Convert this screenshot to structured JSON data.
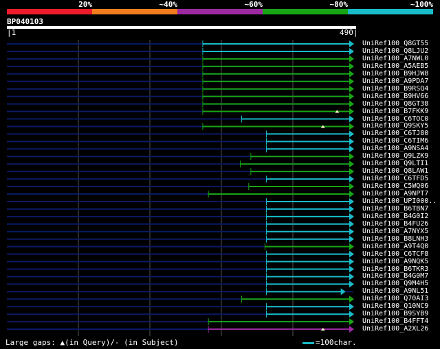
{
  "colors": {
    "background": "#000000",
    "query_line": "#0a1a66",
    "grid": "#555555",
    "id_20": "#ec1c2a",
    "id_40": "#f07c1e",
    "id_60": "#9d2aa0",
    "id_80": "#17a514",
    "id_100": "#19bcc8",
    "gap_marker": "#ffffcc"
  },
  "legend_bar": [
    {
      "label": "20%",
      "color": "#ec1c2a"
    },
    {
      "label": "~40%",
      "color": "#f07c1e"
    },
    {
      "label": "~60%",
      "color": "#9d2aa0"
    },
    {
      "label": "~80%",
      "color": "#17a514"
    },
    {
      "label": "~100%",
      "color": "#19bcc8"
    }
  ],
  "query": {
    "id": "BP040103",
    "start_label": "|1",
    "end_label": "490|",
    "length": 490
  },
  "hits": [
    {
      "label": "UniRef100_Q8GT55",
      "start": 277,
      "end": 490,
      "color": "#19bcc8"
    },
    {
      "label": "UniRef100_Q8LJU2",
      "start": 277,
      "end": 490,
      "color": "#19bcc8"
    },
    {
      "label": "UniRef100_A7NWL0",
      "start": 277,
      "end": 490,
      "color": "#17a514"
    },
    {
      "label": "UniRef100_A5AEB5",
      "start": 277,
      "end": 490,
      "color": "#17a514"
    },
    {
      "label": "UniRef100_B9HJW8",
      "start": 277,
      "end": 490,
      "color": "#17a514"
    },
    {
      "label": "UniRef100_A9PDA7",
      "start": 277,
      "end": 490,
      "color": "#17a514"
    },
    {
      "label": "UniRef100_B9RSQ4",
      "start": 277,
      "end": 490,
      "color": "#17a514"
    },
    {
      "label": "UniRef100_B9HV66",
      "start": 277,
      "end": 490,
      "color": "#17a514"
    },
    {
      "label": "UniRef100_Q8GT38",
      "start": 277,
      "end": 490,
      "color": "#17a514"
    },
    {
      "label": "UniRef100_B7FKK9",
      "start": 277,
      "end": 490,
      "color": "#17a514",
      "gap": 467
    },
    {
      "label": "UniRef100_C6TOC0",
      "start": 332,
      "end": 490,
      "color": "#19bcc8"
    },
    {
      "label": "UniRef100_Q9SKY5",
      "start": 277,
      "end": 490,
      "color": "#17a514",
      "gap": 447
    },
    {
      "label": "UniRef100_C6TJ80",
      "start": 367,
      "end": 490,
      "color": "#19bcc8"
    },
    {
      "label": "UniRef100_C6TIM6",
      "start": 367,
      "end": 490,
      "color": "#19bcc8"
    },
    {
      "label": "UniRef100_A9NSA4",
      "start": 367,
      "end": 490,
      "color": "#19bcc8"
    },
    {
      "label": "UniRef100_Q9LZK9",
      "start": 345,
      "end": 490,
      "color": "#17a514"
    },
    {
      "label": "UniRef100_Q9LTI1",
      "start": 330,
      "end": 490,
      "color": "#17a514"
    },
    {
      "label": "UniRef100_Q8LAW1",
      "start": 345,
      "end": 490,
      "color": "#17a514"
    },
    {
      "label": "UniRef100_C6TFD5",
      "start": 367,
      "end": 490,
      "color": "#19bcc8"
    },
    {
      "label": "UniRef100_C5WQ06",
      "start": 342,
      "end": 490,
      "color": "#17a514"
    },
    {
      "label": "UniRef100_A9NPT7",
      "start": 285,
      "end": 490,
      "color": "#17a514"
    },
    {
      "label": "UniRef100_UPI000..",
      "start": 367,
      "end": 490,
      "color": "#19bcc8"
    },
    {
      "label": "UniRef100_B6TBN7",
      "start": 367,
      "end": 490,
      "color": "#19bcc8"
    },
    {
      "label": "UniRef100_B4G0I2",
      "start": 367,
      "end": 490,
      "color": "#19bcc8"
    },
    {
      "label": "UniRef100_B4FU26",
      "start": 367,
      "end": 490,
      "color": "#19bcc8"
    },
    {
      "label": "UniRef100_A7NYX5",
      "start": 367,
      "end": 490,
      "color": "#19bcc8"
    },
    {
      "label": "UniRef100_B8LNH3",
      "start": 367,
      "end": 490,
      "color": "#19bcc8"
    },
    {
      "label": "UniRef100_A9T4Q0",
      "start": 365,
      "end": 490,
      "color": "#17a514"
    },
    {
      "label": "UniRef100_C6TCF8",
      "start": 367,
      "end": 490,
      "color": "#19bcc8"
    },
    {
      "label": "UniRef100_A9NQK5",
      "start": 367,
      "end": 490,
      "color": "#19bcc8"
    },
    {
      "label": "UniRef100_B6TKR3",
      "start": 367,
      "end": 490,
      "color": "#19bcc8"
    },
    {
      "label": "UniRef100_B4G0M7",
      "start": 367,
      "end": 490,
      "color": "#19bcc8"
    },
    {
      "label": "UniRef100_Q9M4H5",
      "start": 367,
      "end": 490,
      "color": "#19bcc8"
    },
    {
      "label": "UniRef100_A9NL51",
      "start": 367,
      "end": 478,
      "color": "#19bcc8"
    },
    {
      "label": "UniRef100_Q70AI3",
      "start": 332,
      "end": 490,
      "color": "#17a514"
    },
    {
      "label": "UniRef100_Q10NC9",
      "start": 367,
      "end": 490,
      "color": "#19bcc8"
    },
    {
      "label": "UniRef100_B9SYB9",
      "start": 367,
      "end": 490,
      "color": "#19bcc8"
    },
    {
      "label": "UniRef100_B4FFT4",
      "start": 285,
      "end": 490,
      "color": "#17a514"
    },
    {
      "label": "UniRef100_A2XL26",
      "start": 285,
      "end": 490,
      "color": "#9d2aa0",
      "gap": 447
    }
  ],
  "footer": {
    "legend_text": "Large gaps: ▲(in Query)/- (in Subject)",
    "scale_text": "=100char."
  }
}
